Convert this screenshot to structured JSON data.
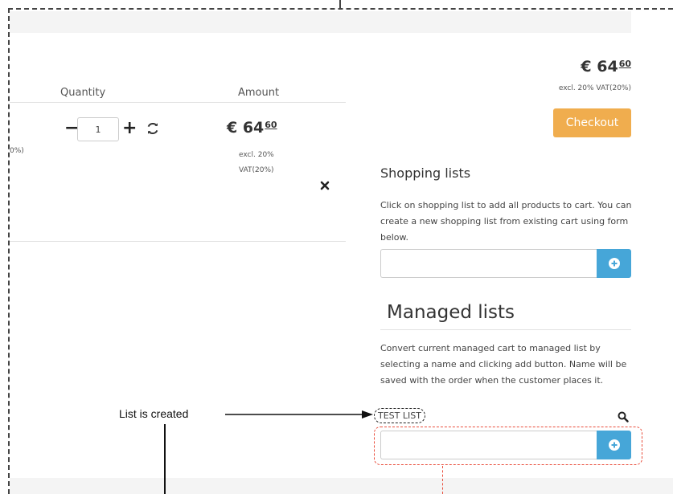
{
  "cart": {
    "columns": {
      "quantity": "Quantity",
      "amount": "Amount"
    },
    "row": {
      "clipped_text": "0%)",
      "quantity_minus": "−",
      "quantity_value": "1",
      "quantity_plus": "+",
      "price_main": "€ 64",
      "price_cents": "60",
      "vat_note": "excl. 20% VAT(20%)"
    }
  },
  "summary": {
    "price_main": "€ 64",
    "price_cents": "60",
    "vat_note": "excl. 20% VAT(20%)",
    "checkout_label": "Checkout"
  },
  "shopping_lists": {
    "title": "Shopping lists",
    "description": "Click on shopping list to add all products to cart. You can create a new shopping list from existing cart using form below.",
    "input_value": ""
  },
  "managed_lists": {
    "title": "Managed lists",
    "description": "Convert current managed cart to managed list by selecting a name and clicking add button. Name will be saved with the order when the customer places it.",
    "current_list": "TEST LIST",
    "input_value": ""
  },
  "annotations": {
    "callout": "List is created"
  },
  "colors": {
    "checkout": "#f0ad4e",
    "add_button": "#46a6d8",
    "highlight": "#e94e3c"
  },
  "icons": [
    "refresh-icon",
    "close-icon",
    "plus-circle-icon",
    "search-icon"
  ]
}
